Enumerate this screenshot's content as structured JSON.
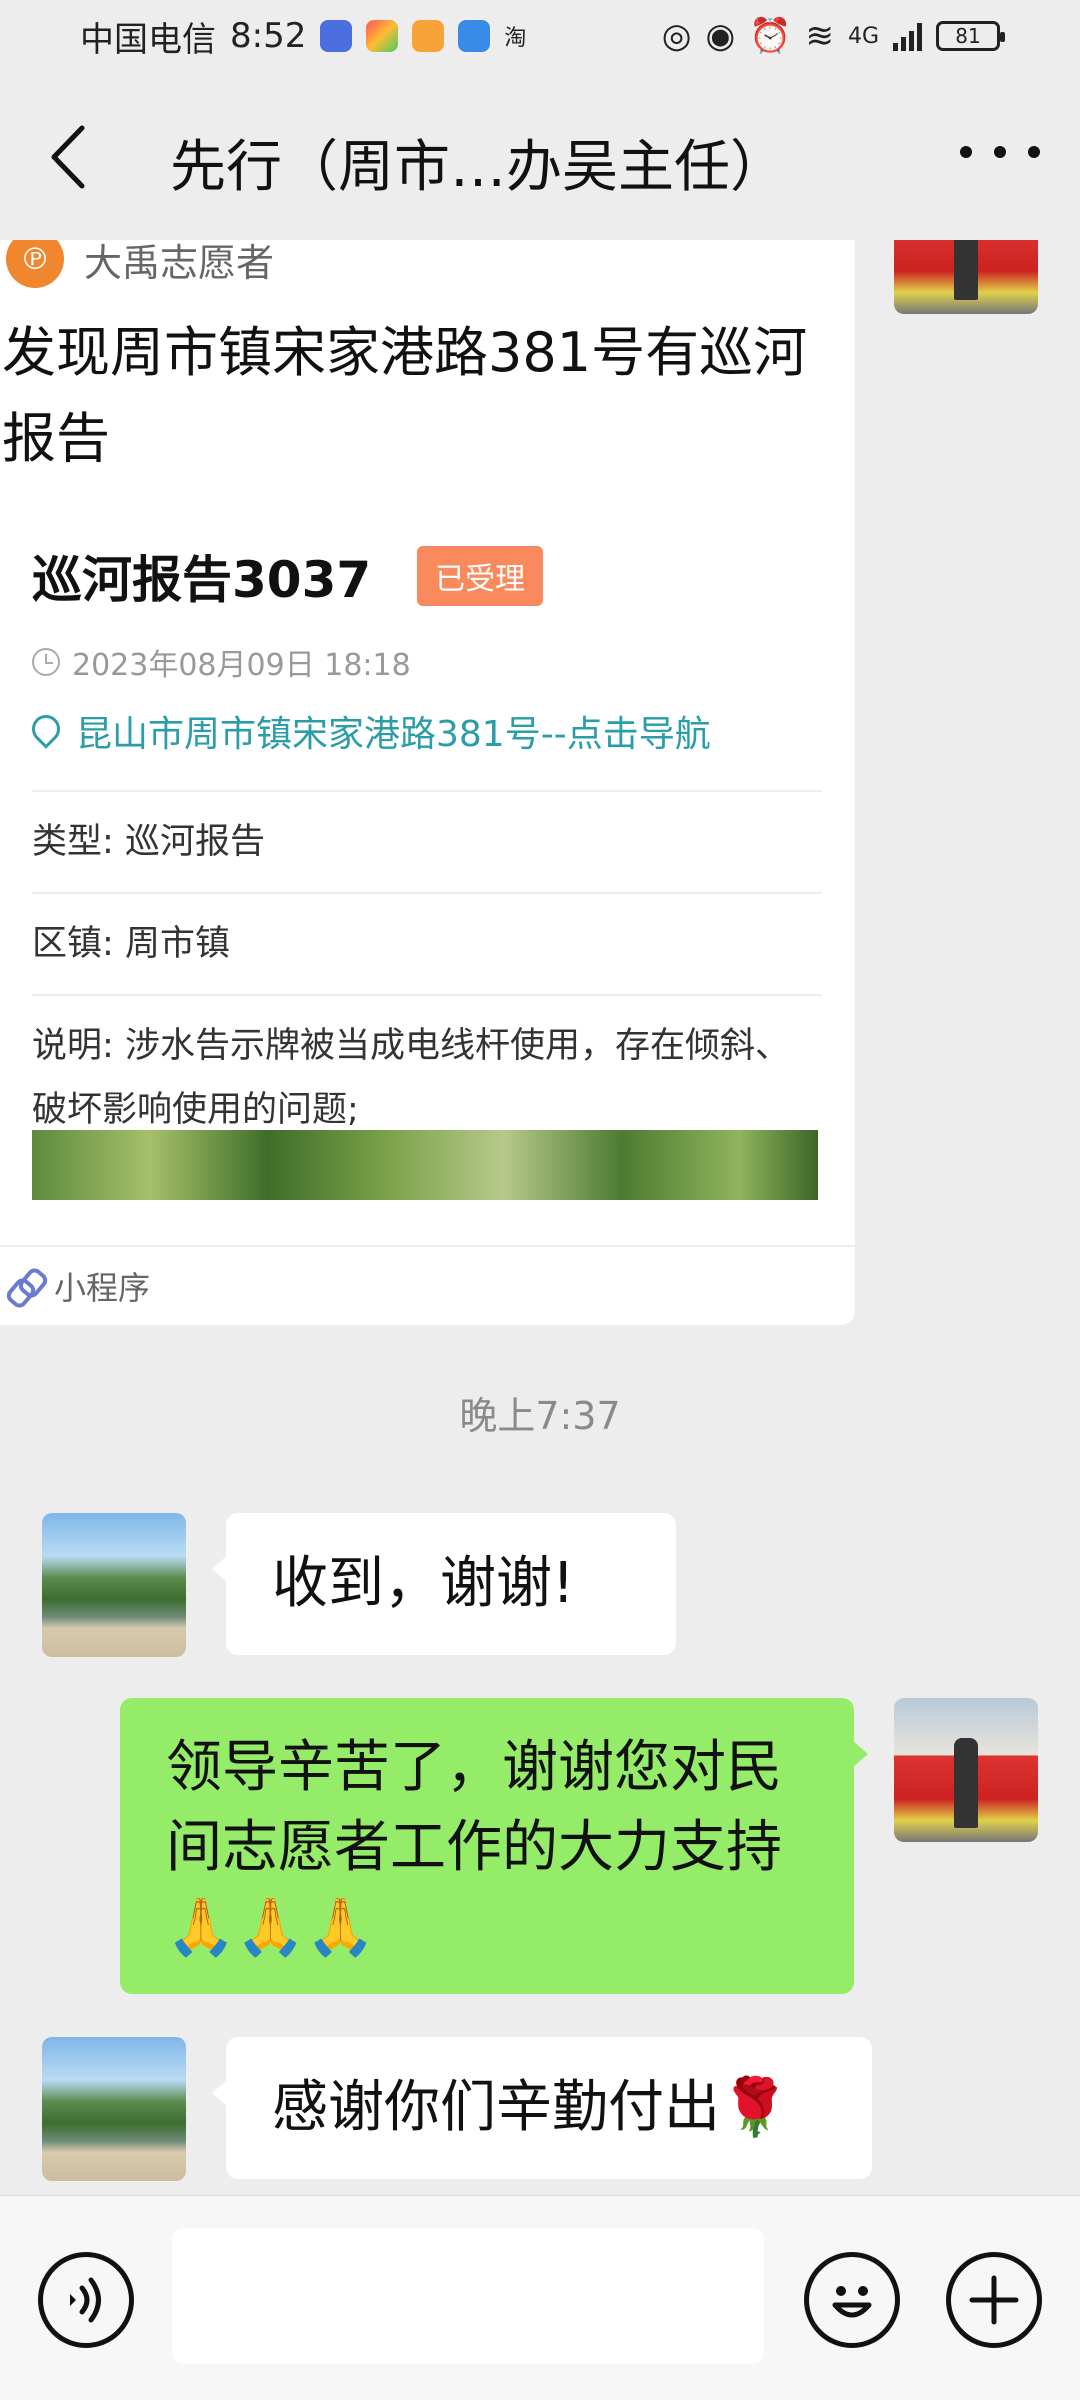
{
  "status_bar": {
    "carrier": "中国电信",
    "time": "8:52",
    "app_icon_label": "淘",
    "network": "4G",
    "battery": "81"
  },
  "nav": {
    "title": "先行（周市…办吴主任）"
  },
  "card": {
    "source": "大禹志愿者",
    "title": "发现周市镇宋家港路381号有巡河报告",
    "report_name": "巡河报告3037",
    "status_badge": "已受理",
    "timestamp": "2023年08月09日 18:18",
    "address": "昆山市周市镇宋家港路381号--点击导航",
    "rows": [
      {
        "label": "类型:",
        "value": "巡河报告"
      },
      {
        "label": "区镇:",
        "value": "周市镇"
      },
      {
        "label": "说明:",
        "value": "涉水告示牌被当成电线杆使用，存在倾斜、破坏影响使用的问题;"
      }
    ],
    "footer": "小程序"
  },
  "time_separator": "晚上7:37",
  "messages": [
    {
      "side": "in",
      "text": "收到，谢谢!"
    },
    {
      "side": "out",
      "text": "领导辛苦了，谢谢您对民间志愿者工作的大力支持",
      "emoji": "🙏🙏🙏"
    },
    {
      "side": "in",
      "text": "感谢你们辛勤付出",
      "emoji": "🌹"
    }
  ]
}
